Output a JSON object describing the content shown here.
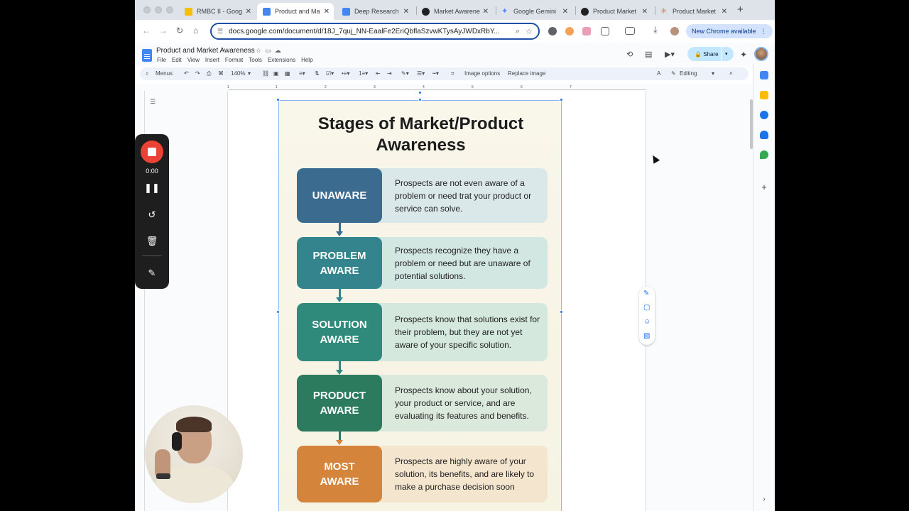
{
  "browser": {
    "tabs": [
      {
        "title": "RMBC II - Goog",
        "favicon_color": "#fbbc04",
        "active": false
      },
      {
        "title": "Product and Ma",
        "favicon_color": "#4285f4",
        "active": true
      },
      {
        "title": "Deep Research",
        "favicon_color": "#4285f4",
        "active": false
      },
      {
        "title": "Market Awarene",
        "favicon_color": "#202124",
        "active": false
      },
      {
        "title": "Google Gemini",
        "favicon_color": "#4c8df6",
        "active": false
      },
      {
        "title": "Product Market",
        "favicon_color": "#202124",
        "active": false
      },
      {
        "title": "Product Market",
        "favicon_color": "#d97757",
        "active": false
      }
    ],
    "url": "docs.google.com/document/d/18J_7quj_NN-EaalFe2EriQbflaSzvwKTysAyJWDxRbY...",
    "new_chrome_label": "New Chrome available"
  },
  "docs": {
    "title": "Product and Market Awareness",
    "menus": [
      "File",
      "Edit",
      "View",
      "Insert",
      "Format",
      "Tools",
      "Extensions",
      "Help"
    ],
    "share_label": "Share",
    "toolbar": {
      "menus_label": "Menus",
      "zoom": "140%",
      "image_options": "Image options",
      "replace_image": "Replace image",
      "mode": "Editing"
    },
    "ruler_numbers": [
      "1",
      "1",
      "2",
      "3",
      "4",
      "5",
      "6",
      "7"
    ]
  },
  "infographic": {
    "title_line1": "Stages of Market/Product",
    "title_line2": "Awareness",
    "stages": [
      {
        "label_line1": "UNAWARE",
        "label_line2": "",
        "description": "Prospects are not even aware of a problem or need trat your product or service can solve.",
        "color": "#3b6b8f",
        "bg": "#dbe8ea"
      },
      {
        "label_line1": "PROBLEM",
        "label_line2": "AWARE",
        "description": "Prospects recognize they have a problem or need but are unaware of potential solutions.",
        "color": "#33848d",
        "bg": "#d3e7e2"
      },
      {
        "label_line1": "SOLUTION",
        "label_line2": "AWARE",
        "description": "Prospects know that solutions exist for their problem, but they are not yet aware of your specific solution.",
        "color": "#2f8a7b",
        "bg": "#d4e8dd"
      },
      {
        "label_line1": "PRODUCT",
        "label_line2": "AWARE",
        "description": "Prospects know about your solution, your product or service, and are evaluating its features and benefits.",
        "color": "#2d7b5f",
        "bg": "#dbe8dc"
      },
      {
        "label_line1": "MOST",
        "label_line2": "AWARE",
        "description": "Prospects are highly aware of your solution, its benefits, and are likely to make a purchase decision soon",
        "color": "#d4843b",
        "bg": "#f4e5cf"
      }
    ]
  },
  "recorder": {
    "time": "0:00",
    "stop_color": "#ea4335"
  }
}
